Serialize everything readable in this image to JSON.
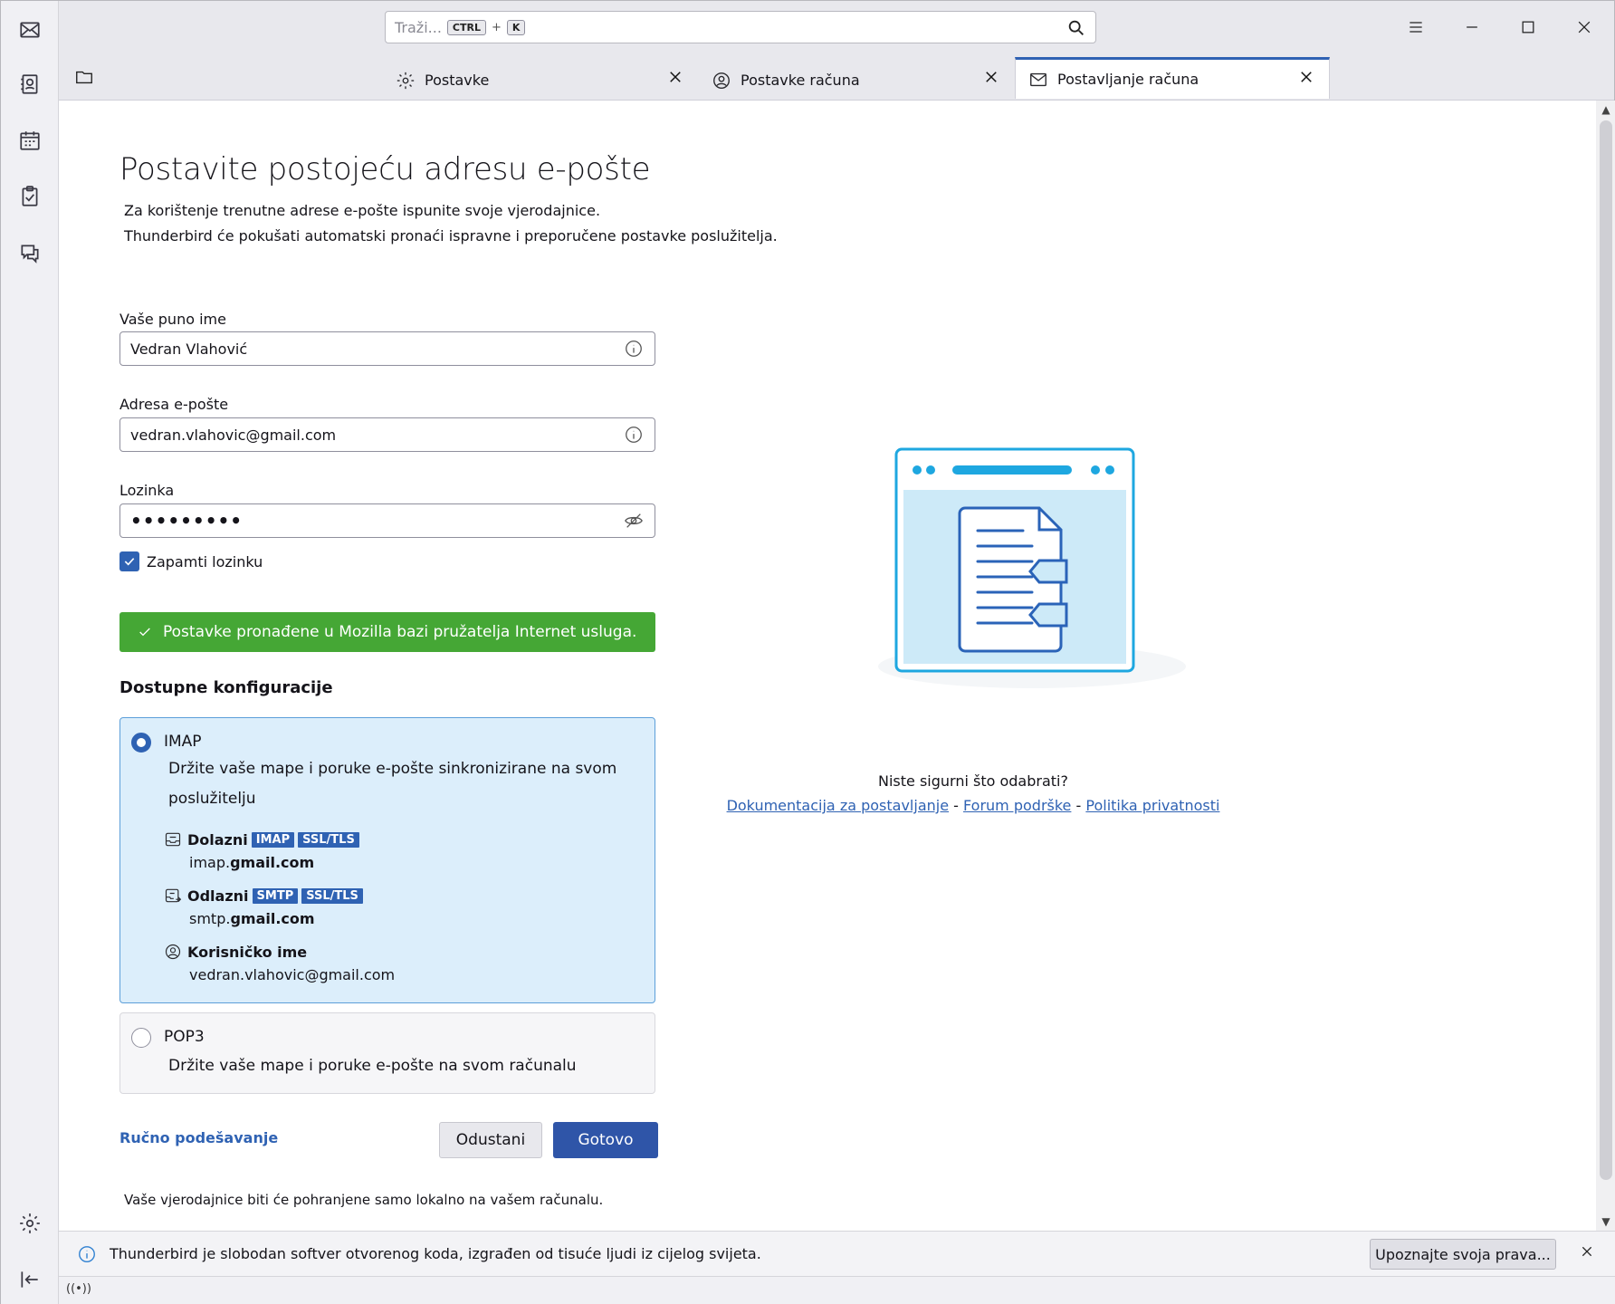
{
  "search": {
    "placeholder": "Traži...",
    "kbd_ctrl": "CTRL",
    "kbd_plus": "+",
    "kbd_k": "K"
  },
  "tabs": [
    {
      "label": "Postavke",
      "icon": "gear-icon"
    },
    {
      "label": "Postavke računa",
      "icon": "account-icon"
    },
    {
      "label": "Postavljanje računa",
      "icon": "mail-setup-icon"
    }
  ],
  "page": {
    "title": "Postavite postojeću adresu e-pošte",
    "subtitle_1": "Za korištenje trenutne adrese e-pošte ispunite svoje vjerodajnice.",
    "subtitle_2": "Thunderbird će pokušati automatski pronaći ispravne i preporučene postavke poslužitelja."
  },
  "form": {
    "name_label": "Vaše puno ime",
    "name_value": "Vedran Vlahović",
    "email_label": "Adresa e-pošte",
    "email_value": "vedran.vlahovic@gmail.com",
    "password_label": "Lozinka",
    "password_value": "•••••••••",
    "remember_label": "Zapamti lozinku",
    "remember_checked": true
  },
  "success_message": "Postavke pronađene u Mozilla bazi pružatelja Internet usluga.",
  "configs": {
    "heading": "Dostupne konfiguracije",
    "imap": {
      "name": "IMAP",
      "desc_1": "Držite vaše mape i poruke e-pošte sinkronizirane na svom",
      "desc_2": "poslužitelju",
      "incoming_label": "Dolazni",
      "incoming_badge_1": "IMAP",
      "incoming_badge_2": "SSL/TLS",
      "incoming_host_prefix": "imap.",
      "incoming_host_domain": "gmail.com",
      "outgoing_label": "Odlazni",
      "outgoing_badge_1": "SMTP",
      "outgoing_badge_2": "SSL/TLS",
      "outgoing_host_prefix": "smtp.",
      "outgoing_host_domain": "gmail.com",
      "username_label": "Korisničko ime",
      "username_value": "vedran.vlahovic@gmail.com"
    },
    "pop3": {
      "name": "POP3",
      "desc": "Držite vaše mape i poruke e-pošte na svom računalu"
    }
  },
  "actions": {
    "manual": "Ručno podešavanje",
    "cancel": "Odustani",
    "done": "Gotovo"
  },
  "footer_note": "Vaše vjerodajnice biti će pohranjene samo lokalno na vašem računalu.",
  "help": {
    "question": "Niste sigurni što odabrati?",
    "link_docs": "Dokumentacija za postavljanje",
    "sep": "-",
    "link_forum": "Forum podrške",
    "link_privacy": "Politika privatnosti"
  },
  "notification": {
    "text": "Thunderbird je slobodan softver otvorenog koda, izgrađen od tisuće ljudi iz cijelog svijeta.",
    "button": "Upoznajte svoja prava..."
  },
  "colors": {
    "accent": "#2f62b3",
    "success": "#45a735",
    "selected_bg": "#dceefb"
  }
}
